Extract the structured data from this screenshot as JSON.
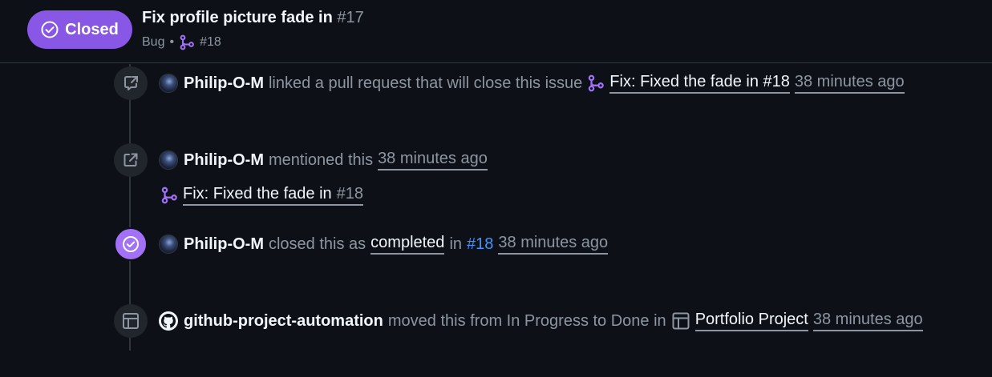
{
  "header": {
    "state_label": "Closed",
    "title": "Fix profile picture fade in",
    "number": "#17",
    "label": "Bug",
    "separator": "•",
    "linked_pr": "#18"
  },
  "colors": {
    "closed_purple": "#8957e5",
    "done_badge": "#a371f7",
    "link_blue": "#4493f8",
    "background": "#0d1117"
  },
  "events": [
    {
      "icon": "cross-reference-icon",
      "actor": "Philip-O-M",
      "text": "linked a pull request that will close this issue",
      "pr_title": "Fix: Fixed the fade in #18",
      "time": "38 minutes ago"
    },
    {
      "icon": "mention-icon",
      "actor": "Philip-O-M",
      "text": "mentioned this",
      "time": "38 minutes ago",
      "pr_title": "Fix: Fixed the fade in",
      "pr_number": "#18"
    },
    {
      "icon": "check-circle-icon",
      "actor": "Philip-O-M",
      "text": "closed this as",
      "reason": "completed",
      "in_text": "in",
      "pr_number": "#18",
      "time": "38 minutes ago"
    },
    {
      "icon": "project-table-icon",
      "actor": "github-project-automation",
      "text": "moved this from In Progress to Done in",
      "project": "Portfolio Project",
      "time": "38 minutes ago"
    }
  ]
}
